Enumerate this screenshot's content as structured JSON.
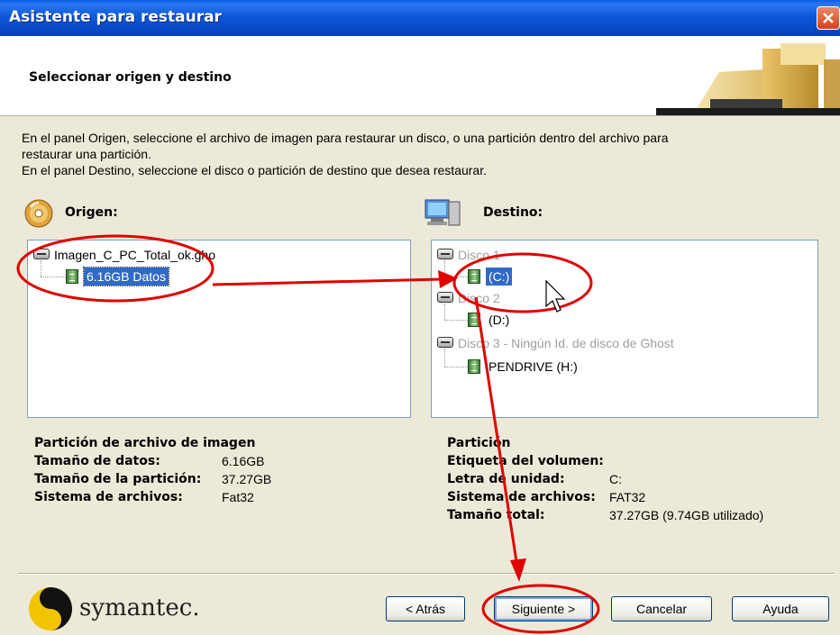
{
  "window": {
    "title": "Asistente para restaurar"
  },
  "header": {
    "subtitle": "Seleccionar origen y destino"
  },
  "intro": {
    "line1": "En el panel Origen, seleccione el archivo de imagen para restaurar un disco, o una partición dentro del archivo para",
    "line2": "restaurar una partición.",
    "line3": "En el panel Destino, seleccione el disco o partición de destino que desea restaurar."
  },
  "origen": {
    "label": "Origen:",
    "tree": {
      "image": "Imagen_C_PC_Total_ok.gho",
      "partition": "6.16GB Datos"
    },
    "info": {
      "heading": "Partición de archivo de imagen",
      "rows": [
        {
          "key": "Tamaño de datos:",
          "value": "6.16GB"
        },
        {
          "key": "Tamaño de la partición:",
          "value": "37.27GB"
        },
        {
          "key": "Sistema de archivos:",
          "value": "Fat32"
        }
      ]
    }
  },
  "destino": {
    "label": "Destino:",
    "tree": {
      "disk1": "Disco 1",
      "disk1_part": "(C:)",
      "disk2": "Disco 2",
      "disk2_part": "(D:)",
      "disk3": "Disco 3 - Ningún Id. de disco de Ghost",
      "disk3_part": "PENDRIVE (H:)"
    },
    "info": {
      "heading": "Partición",
      "rows": [
        {
          "key": "Etiqueta del volumen:",
          "value": ""
        },
        {
          "key": "Letra de unidad:",
          "value": "C:"
        },
        {
          "key": "Sistema de archivos:",
          "value": "FAT32"
        },
        {
          "key": "Tamaño total:",
          "value": "37.27GB (9.74GB utilizado)"
        }
      ]
    }
  },
  "footer": {
    "brand": "symantec.",
    "buttons": {
      "back": "< Atrás",
      "next": "Siguiente >",
      "cancel": "Cancelar",
      "help": "Ayuda"
    }
  },
  "annotations": {
    "color": "#e00000"
  }
}
